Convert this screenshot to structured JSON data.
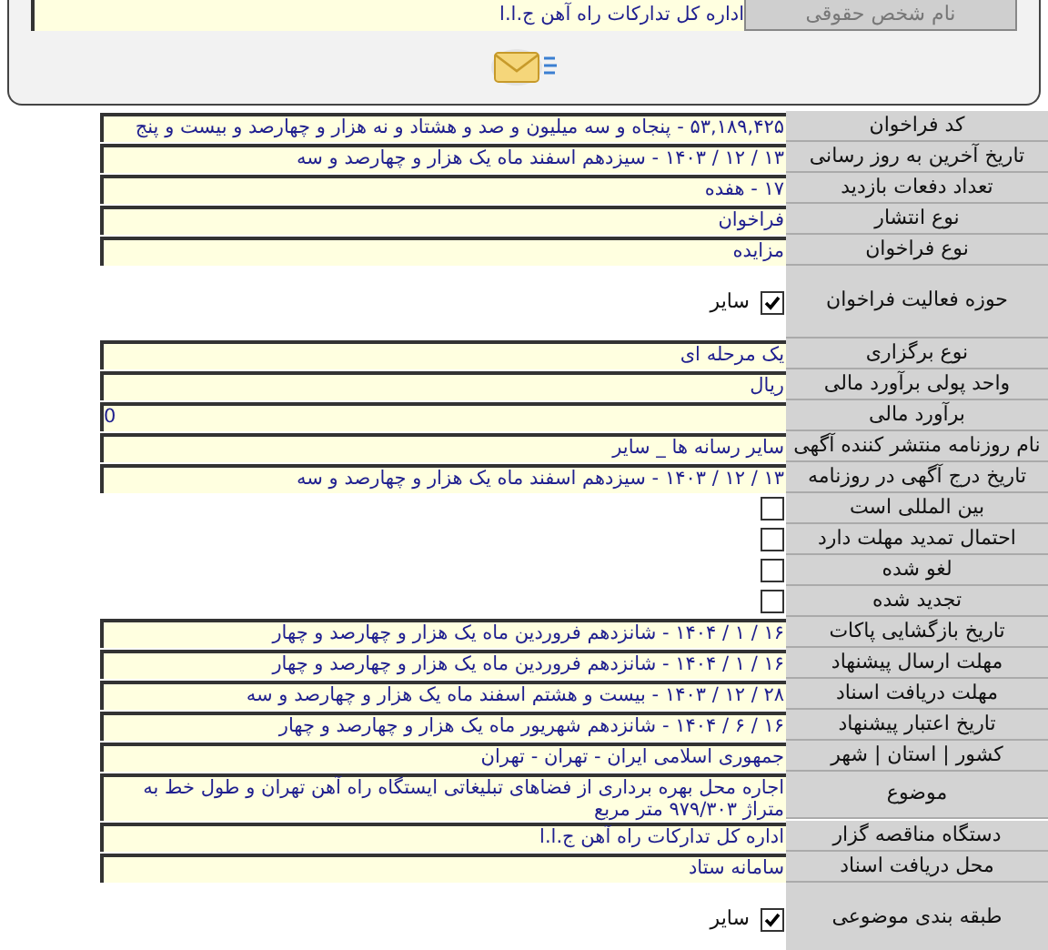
{
  "top_panel": {
    "label": "نام شخص حقوقی",
    "value": "اداره کل تدارکات راه آهن ج.ا.ا"
  },
  "rows": [
    {
      "kind": "text",
      "label": "کد فراخوان",
      "value": "۵۳,۱۸۹,۴۲۵ - پنجاه و سه میلیون و صد و هشتاد و نه هزار و چهارصد و بیست و پنج"
    },
    {
      "kind": "text",
      "label": "تاریخ آخرین به روز رسانی",
      "value": "۱۳ / ۱۲ / ۱۴۰۳ - سیزدهم اسفند ماه یک هزار و چهارصد و سه"
    },
    {
      "kind": "text",
      "label": "تعداد دفعات بازدید",
      "value": "۱۷ - هفده"
    },
    {
      "kind": "text",
      "label": "نوع انتشار",
      "value": "فراخوان"
    },
    {
      "kind": "text",
      "label": "نوع فراخوان",
      "value": "مزایده"
    },
    {
      "kind": "checklist",
      "label": "حوزه فعالیت فراخوان",
      "options": [
        {
          "label": "سایر",
          "checked": true
        }
      ]
    },
    {
      "kind": "text",
      "label": "نوع برگزاری",
      "value": "یک مرحله ای"
    },
    {
      "kind": "text",
      "label": "واحد پولی برآورد مالی",
      "value": "ریال"
    },
    {
      "kind": "text",
      "label": "برآورد مالی",
      "value": "0"
    },
    {
      "kind": "text",
      "label": "نام روزنامه منتشر کننده آگهی",
      "value": "سایر رسانه ها _ سایر"
    },
    {
      "kind": "text",
      "label": "تاریخ درج آگهی در روزنامه",
      "value": "۱۳ / ۱۲ / ۱۴۰۳ - سیزدهم اسفند ماه یک هزار و چهارصد و سه"
    },
    {
      "kind": "checkbox",
      "label": "بین المللی است",
      "checked": false
    },
    {
      "kind": "checkbox",
      "label": "احتمال تمدید مهلت دارد",
      "checked": false
    },
    {
      "kind": "checkbox",
      "label": "لغو شده",
      "checked": false
    },
    {
      "kind": "checkbox",
      "label": "تجدید شده",
      "checked": false
    },
    {
      "kind": "text",
      "label": "تاریخ بازگشایی پاکات",
      "value": "۱۶ / ۱ / ۱۴۰۴ - شانزدهم فروردین ماه یک هزار و چهارصد و چهار"
    },
    {
      "kind": "text",
      "label": "مهلت ارسال پیشنهاد",
      "value": "۱۶ / ۱ / ۱۴۰۴ - شانزدهم فروردین ماه یک هزار و چهارصد و چهار"
    },
    {
      "kind": "text",
      "label": "مهلت دریافت اسناد",
      "value": "۲۸ / ۱۲ / ۱۴۰۳ - بیست و هشتم اسفند ماه یک هزار و چهارصد و سه"
    },
    {
      "kind": "text",
      "label": "تاریخ اعتبار پیشنهاد",
      "value": "۱۶ / ۶ / ۱۴۰۴ - شانزدهم شهریور ماه یک هزار و چهارصد و چهار"
    },
    {
      "kind": "text",
      "label": "کشور | استان | شهر",
      "value": "جمهوری اسلامی ایران - تهران - تهران"
    },
    {
      "kind": "text",
      "label": "موضوع",
      "value": "اجاره محل بهره برداری از فضاهای تبلیغاتی ایستگاه راه آهن تهران و طول خط به متراژ ۹۷۹/۳۰۳ متر مربع"
    },
    {
      "kind": "text",
      "label": "دستگاه مناقصه گزار",
      "value": "اداره کل تدارکات راه آهن ج.ا.ا"
    },
    {
      "kind": "text",
      "label": "محل دریافت اسناد",
      "value": "سامانه ستاد"
    },
    {
      "kind": "checklist",
      "label": "طبقه بندی موضوعی",
      "options": [
        {
          "label": "سایر",
          "checked": true
        }
      ]
    }
  ]
}
